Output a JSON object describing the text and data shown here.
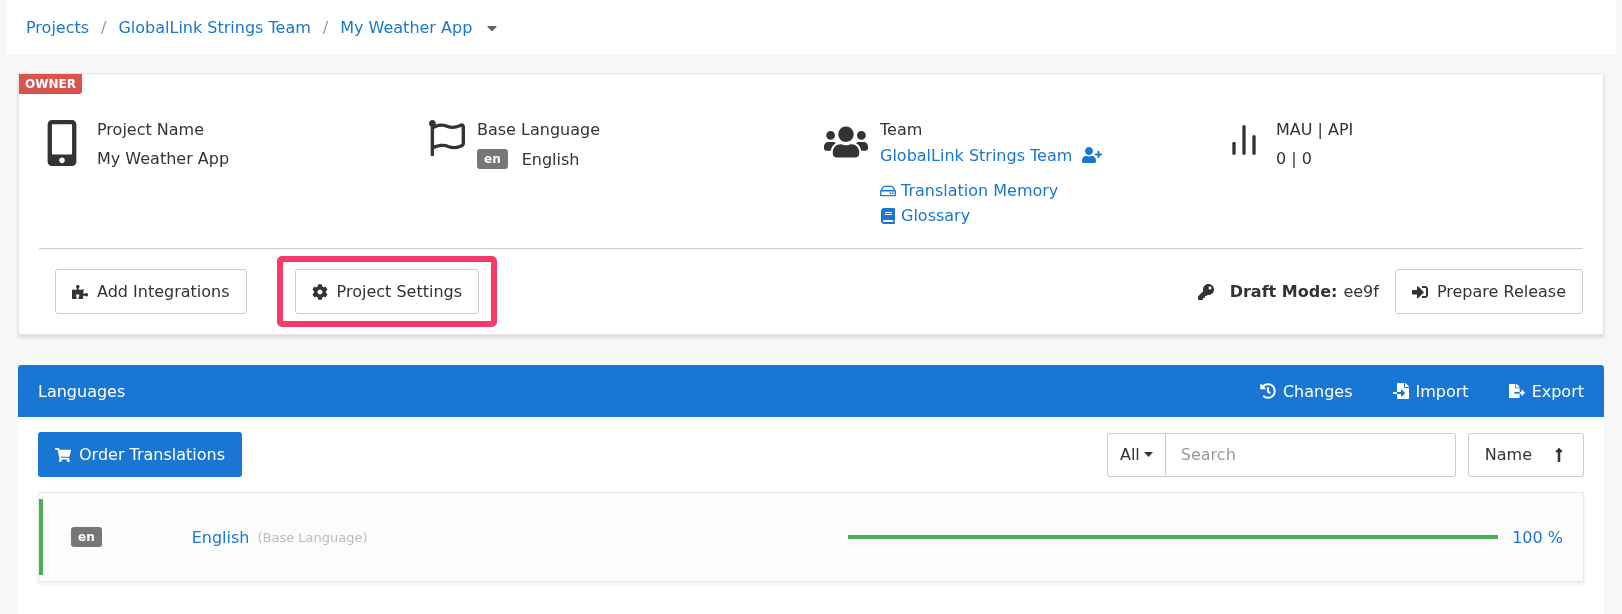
{
  "breadcrumb": [
    {
      "label": "Projects"
    },
    {
      "separator": "/",
      "label": "GlobalLink Strings Team"
    },
    {
      "separator": "/",
      "label": "My Weather App"
    }
  ],
  "project": {
    "role_badge": "OWNER",
    "name": {
      "label": "Project Name",
      "value": "My Weather App"
    },
    "base_language": {
      "label": "Base Language",
      "code": "en",
      "value": "English"
    },
    "team": {
      "label": "Team",
      "value": "GlobalLink Strings Team",
      "links": [
        {
          "kind": "memory",
          "label": "Translation Memory"
        },
        {
          "kind": "glossary",
          "label": "Glossary"
        }
      ]
    },
    "usage": {
      "label": "MAU | API",
      "value": "0 | 0"
    },
    "actions": [
      {
        "kind": "integrations",
        "label": "Add Integrations",
        "highlighted": false
      },
      {
        "kind": "settings",
        "label": "Project Settings",
        "highlighted": true
      }
    ],
    "draft": {
      "label": "Draft Mode:",
      "value": "ee9f"
    },
    "release_button": "Prepare Release"
  },
  "languages": {
    "title": "Languages",
    "header_actions": [
      {
        "kind": "changes",
        "label": "Changes"
      },
      {
        "kind": "import",
        "label": "Import"
      },
      {
        "kind": "export",
        "label": "Export"
      }
    ],
    "order_button": "Order Translations",
    "filter": "All",
    "search": {
      "placeholder": "Search"
    },
    "sort": "Name",
    "rows": [
      {
        "code": "en",
        "name": "English",
        "note": "(Base Language)",
        "level": 1,
        "reading": "100 %"
      }
    ]
  }
}
